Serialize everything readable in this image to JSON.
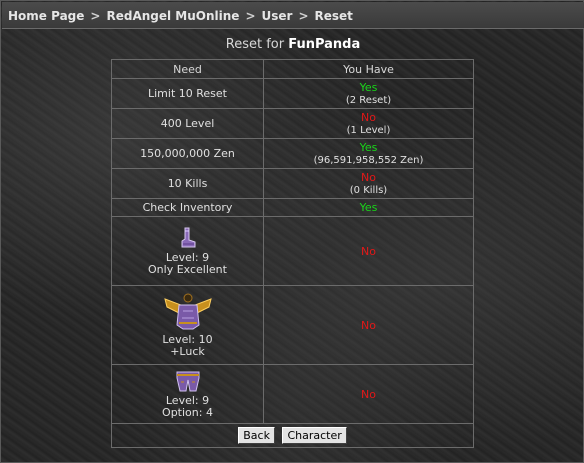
{
  "breadcrumb": [
    "Home Page",
    "RedAngel MuOnline",
    "User",
    "Reset"
  ],
  "breadcrumb_separator": ">",
  "title": {
    "prefix": "Reset for",
    "character": "FunPanda"
  },
  "table": {
    "headers": [
      "Need",
      "You Have"
    ],
    "rows": [
      {
        "need": "Limit 10 Reset",
        "status": "Yes",
        "detail": "(2 Reset)"
      },
      {
        "need": "400 Level",
        "status": "No",
        "detail": "(1 Level)"
      },
      {
        "need": "150,000,000 Zen",
        "status": "Yes",
        "detail": "(96,591,958,552 Zen)"
      },
      {
        "need": "10 Kills",
        "status": "No",
        "detail": "(0 Kills)"
      },
      {
        "need": "Check Inventory",
        "status": "Yes"
      }
    ],
    "items": [
      {
        "icon": "boots-icon",
        "line1": "Level: 9",
        "line2": "Only Excellent",
        "status": "No"
      },
      {
        "icon": "winged-armor-icon",
        "line1": "Level: 10",
        "line2": "+Luck",
        "status": "No"
      },
      {
        "icon": "pants-icon",
        "line1": "Level: 9",
        "line2": "Option: 4",
        "status": "No"
      }
    ]
  },
  "buttons": {
    "back": "Back",
    "character": "Character"
  },
  "colors": {
    "yes": "#19d619",
    "no": "#e21818"
  }
}
